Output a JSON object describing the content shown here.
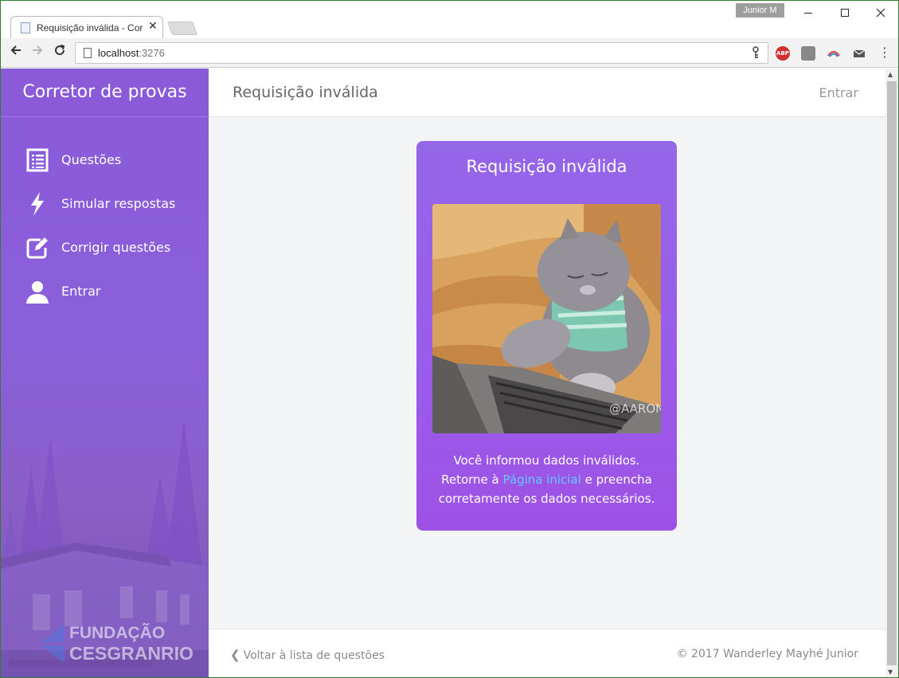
{
  "browser": {
    "tab_title": "Requisição inválida - Cor",
    "tab_close": "✕",
    "user_name": "Junior M",
    "url_host": "localhost",
    "url_port": ":3276",
    "ext_abp": "ABP"
  },
  "sidebar": {
    "title": "Corretor de provas",
    "items": [
      {
        "label": "Questões",
        "icon": "list-icon"
      },
      {
        "label": "Simular respostas",
        "icon": "bolt-icon"
      },
      {
        "label": "Corrigir questões",
        "icon": "edit-icon"
      },
      {
        "label": "Entrar",
        "icon": "user-icon"
      }
    ],
    "logo_line1": "FUNDAÇÃO",
    "logo_line2": "CESGRANRIO"
  },
  "header": {
    "title": "Requisição inválida",
    "login_label": "Entrar"
  },
  "card": {
    "title": "Requisição inválida",
    "image_watermark": "@AARON",
    "text_line1": "Você informou dados inválidos.",
    "text_pre_link": "Retorne à ",
    "link_label": "Página inicial",
    "text_post_link": " e preencha",
    "text_line3": "corretamente os dados necessários."
  },
  "footer": {
    "back_label": "Voltar à lista de questões",
    "copyright": "© 2017 Wanderley Mayhé Junior"
  },
  "colors": {
    "sidebar": "#8a5ad9",
    "card": "#9a5cea",
    "link": "#64c8ff"
  }
}
